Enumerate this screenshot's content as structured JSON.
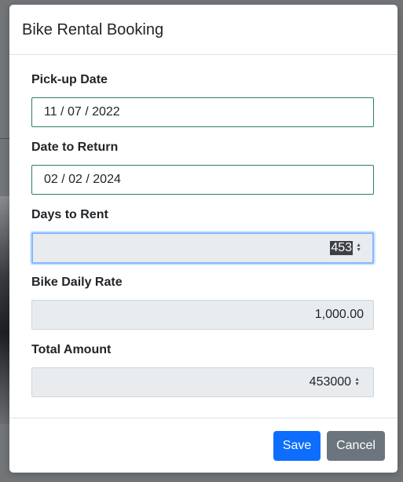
{
  "modal": {
    "title": "Bike Rental Booking"
  },
  "form": {
    "pickup": {
      "label": "Pick-up Date",
      "value": "11 / 07 / 2022"
    },
    "return": {
      "label": "Date to Return",
      "value": "02 / 02 / 2024"
    },
    "days": {
      "label": "Days to Rent",
      "value": "453"
    },
    "rate": {
      "label": "Bike Daily Rate",
      "value": "1,000.00"
    },
    "total": {
      "label": "Total Amount",
      "value": "453000"
    }
  },
  "footer": {
    "save_label": "Save",
    "cancel_label": "Cancel"
  },
  "colors": {
    "primary": "#0d6efd",
    "secondary": "#6c757d",
    "date_border": "#2e7d6b",
    "focus_border": "#86b7fe",
    "readonly_bg": "#e9ecef"
  }
}
